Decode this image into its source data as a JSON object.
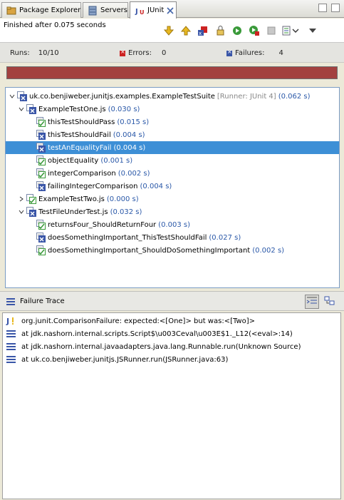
{
  "tabs": [
    {
      "label": "Package Explorer",
      "icon": "package-explorer-icon"
    },
    {
      "label": "Servers",
      "icon": "servers-icon"
    },
    {
      "label": "JUnit",
      "icon": "junit-icon",
      "active": true
    }
  ],
  "status": {
    "text": "Finished after 0.075 seconds"
  },
  "counters": {
    "runs_label": "Runs:",
    "runs_value": "10/10",
    "errors_label": "Errors:",
    "errors_value": "0",
    "failures_label": "Failures:",
    "failures_value": "4"
  },
  "progress": {
    "fraction": 1.0,
    "color": "#a3413f"
  },
  "tree": [
    {
      "depth": 0,
      "kind": "suite",
      "status": "fail",
      "expanded": true,
      "label": "uk.co.benjiweber.junitjs.examples.ExampleTestSuite",
      "runner": "[Runner: JUnit 4]",
      "time": "(0.062 s)"
    },
    {
      "depth": 1,
      "kind": "suite",
      "status": "fail",
      "expanded": true,
      "label": "ExampleTestOne.js",
      "time": "(0.030 s)"
    },
    {
      "depth": 2,
      "kind": "test",
      "status": "pass",
      "label": "thisTestShouldPass",
      "time": "(0.015 s)"
    },
    {
      "depth": 2,
      "kind": "test",
      "status": "fail",
      "label": "thisTestShouldFail",
      "time": "(0.004 s)"
    },
    {
      "depth": 2,
      "kind": "test",
      "status": "fail",
      "label": "testAnEqualityFail",
      "time": "(0.004 s)",
      "selected": true
    },
    {
      "depth": 2,
      "kind": "test",
      "status": "pass",
      "label": "objectEquality",
      "time": "(0.001 s)"
    },
    {
      "depth": 2,
      "kind": "test",
      "status": "pass",
      "label": "integerComparison",
      "time": "(0.002 s)"
    },
    {
      "depth": 2,
      "kind": "test",
      "status": "fail",
      "label": "failingIntegerComparison",
      "time": "(0.004 s)"
    },
    {
      "depth": 1,
      "kind": "suite",
      "status": "pass",
      "expanded": false,
      "label": "ExampleTestTwo.js",
      "time": "(0.000 s)"
    },
    {
      "depth": 1,
      "kind": "suite",
      "status": "fail",
      "expanded": true,
      "label": "TestFileUnderTest.js",
      "time": "(0.032 s)"
    },
    {
      "depth": 2,
      "kind": "test",
      "status": "pass",
      "label": "returnsFour_ShouldReturnFour",
      "time": "(0.003 s)"
    },
    {
      "depth": 2,
      "kind": "test",
      "status": "fail",
      "label": "doesSomethingImportant_ThisTestShouldFail",
      "time": "(0.027 s)"
    },
    {
      "depth": 2,
      "kind": "test",
      "status": "pass",
      "label": "doesSomethingImportant_ShouldDoSomethingImportant",
      "time": "(0.002 s)"
    }
  ],
  "trace": {
    "title": "Failure Trace",
    "lines": [
      {
        "icon": "exception-icon",
        "text": "org.junit.ComparisonFailure: expected:<[One]> but was:<[Two]>"
      },
      {
        "icon": "stack-frame-icon",
        "text": "at jdk.nashorn.internal.scripts.Script$\\u003Ceval\\u003E$1._L12(<eval>:14)"
      },
      {
        "icon": "stack-frame-icon",
        "text": "at jdk.nashorn.internal.javaadapters.java.lang.Runnable.run(Unknown Source)"
      },
      {
        "icon": "stack-frame-icon",
        "text": "at uk.co.benjiweber.junitjs.JSRunner.run(JSRunner.java:63)"
      }
    ]
  },
  "colors": {
    "pass": "#3a9a3a",
    "fail": "#3a56a8",
    "selection": "#3d8fd6",
    "time": "#2a58a8"
  }
}
